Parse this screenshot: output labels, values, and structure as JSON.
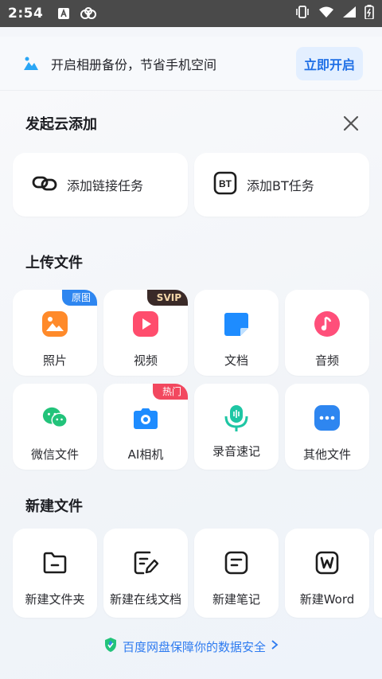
{
  "status_bar": {
    "time": "2:54"
  },
  "banner": {
    "text": "开启相册备份，节省手机空间",
    "button": "立即开启"
  },
  "cloud_add": {
    "title": "发起云添加",
    "items": [
      {
        "label": "添加链接任务",
        "icon": "link-icon"
      },
      {
        "label": "添加BT任务",
        "icon": "bt-icon"
      }
    ]
  },
  "upload": {
    "title": "上传文件",
    "items": [
      {
        "label": "照片",
        "icon": "photo-icon",
        "tag": "原图",
        "tag_color": "#2e86f0"
      },
      {
        "label": "视频",
        "icon": "video-icon",
        "tag": "SVIP",
        "tag_color": "#3a2a28"
      },
      {
        "label": "文档",
        "icon": "document-icon"
      },
      {
        "label": "音频",
        "icon": "audio-icon"
      },
      {
        "label": "微信文件",
        "icon": "wechat-icon"
      },
      {
        "label": "AI相机",
        "icon": "camera-icon",
        "tag": "热门",
        "tag_color": "#f2485f"
      },
      {
        "label": "录音速记",
        "icon": "microphone-icon"
      },
      {
        "label": "其他文件",
        "icon": "more-icon"
      }
    ]
  },
  "new_file": {
    "title": "新建文件",
    "items": [
      {
        "label": "新建文件夹",
        "icon": "folder-icon"
      },
      {
        "label": "新建在线文档",
        "icon": "edit-doc-icon"
      },
      {
        "label": "新建笔记",
        "icon": "note-icon"
      },
      {
        "label": "新建Word",
        "icon": "word-icon"
      }
    ]
  },
  "footer": {
    "text": "百度网盘保障你的数据安全"
  },
  "colors": {
    "accent": "#2e7bf0",
    "photo": "#ff8a2a",
    "video": "#ff4d6d",
    "doc": "#1e8cff",
    "audio": "#ff4f7a",
    "wechat": "#22c37a",
    "camera": "#1e8cff",
    "mic": "#1ec6a4",
    "more": "#2e86f0"
  }
}
